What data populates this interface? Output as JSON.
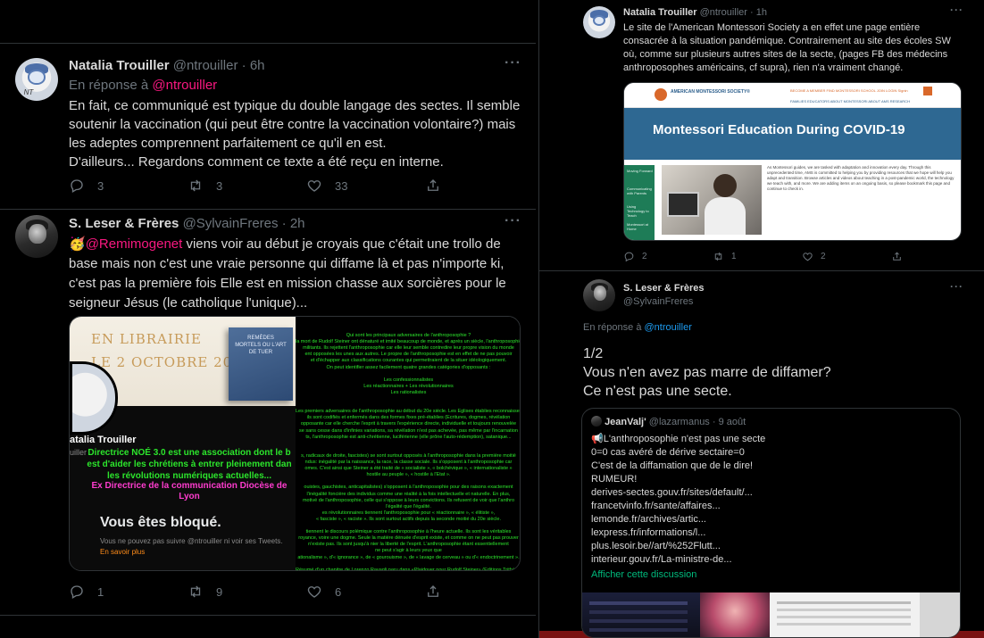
{
  "left": {
    "tweet1": {
      "name": "Natalia Trouiller",
      "handle": "@ntrouiller",
      "dot": "·",
      "time": "6h",
      "reply_prefix": "En réponse à",
      "reply_to": "@ntrouiller",
      "lines": [
        "En fait, ce communiqué est typique du double langage des sectes. Il semble",
        "soutenir la vaccination (qui peut être contre la vaccination volontaire?) mais",
        "les adeptes comprennent parfaitement ce qu'il en est.",
        "D'ailleurs... Regardons comment ce texte a été reçu en interne."
      ],
      "replies": "3",
      "retweets": "3",
      "likes": "33"
    },
    "tweet2": {
      "name": "S. Leser & Frères",
      "handle": "@SylvainFreres",
      "dot": "·",
      "time": "2h",
      "emoji": "🥳",
      "mention": "@Remimogenet",
      "line1_rest": " viens voir au début je croyais que c'était une trollo de",
      "lines": [
        "base mais non c'est une vraie personne qui diffame là et pas n'importe ki,",
        "c'est pas la première fois Elle est en mission chasse aux sorcières pour le",
        "seigneur Jésus (le catholique l'unique)..."
      ],
      "replies": "1",
      "retweets": "9",
      "likes": "6",
      "media": {
        "librairie_l1": "EN LIBRAIRIE",
        "librairie_l2": "LE 2 OCTOBRE 2020",
        "book_title": "REMÈDES MORTELS OU L'ART DE TUER",
        "profile_name": "atalia Trouiller",
        "profile_handle": "uiller",
        "green_text": "Directrice NOÉ 3.0 est une association dont le b est d'aider les chrétiens à entrer pleinement dan les révolutions numériques actuelles...",
        "magenta_text": "Ex Directrice de la communication Diocèse de Lyon",
        "blocked_title": "Vous êtes bloqué.",
        "blocked_sub": "Vous ne pouvez pas suivre @ntrouiller ni voir ses Tweets.",
        "blocked_link": "En savoir plus",
        "right_lines": [
          "Qui sont les principaux adversaires de l'anthroposophie ?",
          "la mort de Rudolf Steiner ont dénaturé et imité beaucoup de monde, et après un siècle, l'anthroposophie",
          "militants. Ils rejettent l'anthroposophie car elle leur semble contredire leur propre vision du monde",
          "ent opposées les unes aux autres. Le propre de l'anthroposophie est en effet de ne pas pouvoir",
          "et d'échapper aux classifications courantes qui permettraient de la situer idéologiquement.",
          "On peut identifier assez facilement quatre grandes catégories d'opposants :",
          "",
          "Les confessionnalistes",
          "Les réactionnaires + Les révolutionnaires",
          "Les rationalistes",
          "",
          "",
          "Les premiers adversaires de l'anthroposophie au début du 20e siècle. Les Églises établies reconnaissent",
          "ils sont codifiés et enfermés dans des formes fixes pré-établies (Écritures, dogmes, révélation",
          "opposante car elle cherche l'esprit à travers l'expérience directe, individuelle et toujours renouvelée",
          "se sans cesse dans d'infinies variations, sa révélation n'est pas achevée, pas même par l'incarnation",
          "ts, l'anthroposophie est anti-chrétienne, luciférienne (elle prône l'auto-rédemption), satanique...",
          "",
          "",
          "s, radicaux de droite, fascistes) se sont surtout opposés à l'anthroposophie dans la première moitié",
          "ndus: inégalité par la naissance, la race, la classe sociale. Ils s'opposent à l'anthroposophie car",
          "omes. C'est ainsi que Steiner a été traité de « socialiste », « bolchévique », « internationaliste »",
          "hostile au peuple », « hostile à l'État ».",
          "",
          "ouistes, gauchistes, anticapitalistes) s'opposent à l'anthroposophie pour des raisons exactement",
          "l'inégalité foncière des individus comme une réalité à la fois intellectuelle et naturelle. En plus,",
          "motivé de l'anthroposophie, celle qui s'oppose à leurs convictions. Ils refusent de voir que l'anthro",
          "l'égalité que l'égalité.",
          "es révolutionnaires tiennent l'anthroposophie pour « réactionnaire », « élitiste »,",
          "« fasciste », « raciste ». Ils sont surtout actifs depuis la seconde moitié du 20e siècle.",
          "",
          "tiennent le discours polémique contre l'anthroposophie à l'heure actuelle. Ils sont les véritables",
          "royance, voire une dogme. Seule la matière dénuée d'esprit existe, et comme on ne peut pas prouver",
          "n'existe pas. Ils sont jusqu'à nier la liberté de l'esprit. L'anthroposophie étant essentiellement",
          "ne peut s'agir à leurs yeux que",
          "ationalisme », d'« ignorance », de « gourouisme », de « lavage de cerveau » ou d'« endoctrinement ».",
          "",
          "Résumé d'un chapitre de Lorenzo Ravagli paru dans «Plaidoyer pour Rudolf Steiner» (Éditions Trithème)"
        ]
      }
    }
  },
  "right": {
    "tweet1": {
      "name": "Natalia Trouiller",
      "handle": "@ntrouiller",
      "dot": "·",
      "time": "1h",
      "lines": [
        "Le site de l'American Montessori Society a en effet une page entière",
        "consacrée à la situation pandémique. Contrairement au site des écoles SW",
        "où, comme sur plusieurs autres sites de la secte, (pages FB des médecins",
        "anthroposophes américains, cf supra), rien n'a vraiment changé."
      ],
      "replies": "2",
      "retweets": "1",
      "likes": "2",
      "media": {
        "logo_text": "AMERICAN MONTESSORI SOCIETY®",
        "nav_top": "BECOME A MEMBER   FIND MONTESSORI SCHOOL   JOIN   LOGIN   Signin",
        "nav_bottom": "FAMILIES   EDUCATORS   ABOUT MONTESSORI   ABOUT AMS   RESEARCH",
        "hero_title": "Montessori Education During COVID-19",
        "side_items": [
          "Moving Forward",
          "Communicating with Parents",
          "Using Technology to Teach",
          "Montessori at Home"
        ],
        "paragraph": "As Montessori guides, we are tasked with adaptation and innovation every day. Through this unprecedented time, AMS is committed to helping you by providing resources that we hope will help you adapt and transition. Browse articles and videos about teaching in a post-pandemic world, the technology we teach with, and more. We are adding items on an ongoing basis, so please bookmark this page and continue to check in."
      }
    },
    "tweet2": {
      "name": "S. Leser & Frères",
      "handle": "@SylvainFreres",
      "reply_prefix": "En réponse à",
      "reply_to": "@ntrouiller",
      "lines": [
        "1/2",
        "Vous n'en avez pas marre de diffamer?",
        "Ce n'est pas une secte."
      ],
      "quote": {
        "name": "JeanValj'",
        "handle": "@lazarmanus",
        "dot": "·",
        "time": "9 août",
        "emoji": "📢",
        "lines": [
          "L'anthroposophie n'est pas une secte",
          "0=0 cas avéré de dérive sectaire=0",
          "C'est de la diffamation que de le dire!",
          "RUMEUR!",
          "derives-sectes.gouv.fr/sites/default/...",
          "francetvinfo.fr/sante/affaires...",
          "lemonde.fr/archives/artic...",
          "lexpress.fr/informations/l...",
          "plus.lesoir.be//art/%252Flutt...",
          "interieur.gouv.fr/La-ministre-de..."
        ],
        "show_thread": "Afficher cette discussion"
      }
    }
  },
  "colors": {
    "background": "#000000",
    "text": "#d9d9d9",
    "secondary": "#6e767d",
    "link": "#1d9bf0",
    "mention_pink": "#f91880",
    "quote_link": "#00ba7c",
    "divider": "#2f3336"
  }
}
